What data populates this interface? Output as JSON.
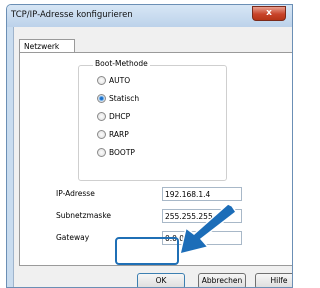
{
  "window": {
    "title": "TCP/IP-Adresse konfigurieren",
    "close_glyph": "x"
  },
  "tabs": [
    {
      "label": "Netzwerk",
      "selected": true
    }
  ],
  "boot_method": {
    "legend": "Boot-Methode",
    "options": [
      {
        "label": "AUTO",
        "checked": false
      },
      {
        "label": "Statisch",
        "checked": true
      },
      {
        "label": "DHCP",
        "checked": false
      },
      {
        "label": "RARP",
        "checked": false
      },
      {
        "label": "BOOTP",
        "checked": false
      }
    ]
  },
  "fields": {
    "ip_address": {
      "label": "IP-Adresse",
      "value": "192.168.1.4"
    },
    "subnet_mask": {
      "label": "Subnetzmaske",
      "value": "255.255.255.0"
    },
    "gateway": {
      "label": "Gateway",
      "value": "0.0.0"
    }
  },
  "buttons": {
    "ok": "OK",
    "cancel": "Abbrechen",
    "help": "Hilfe"
  },
  "colors": {
    "highlight_frame": "#1f6fb5",
    "arrow": "#1c6db8",
    "radio_selected": "#1b6fc8"
  }
}
